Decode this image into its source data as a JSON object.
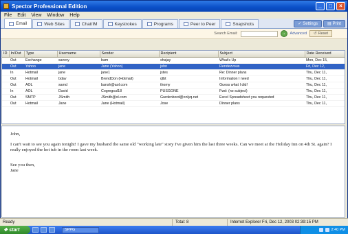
{
  "window": {
    "title": "Spector Professional Edition"
  },
  "menu": [
    "File",
    "Edit",
    "View",
    "Window",
    "Help"
  ],
  "tabs": [
    {
      "label": "Email",
      "icon": "email-icon",
      "active": true
    },
    {
      "label": "Web Sites",
      "icon": "web-icon"
    },
    {
      "label": "Chat/IM",
      "icon": "chat-icon"
    },
    {
      "label": "Keystrokes",
      "icon": "keyboard-icon"
    },
    {
      "label": "Programs",
      "icon": "programs-icon"
    },
    {
      "label": "Peer to Peer",
      "icon": "peer-icon"
    },
    {
      "label": "Snapshots",
      "icon": "camera-icon"
    }
  ],
  "toolbar": {
    "settings": "Settings",
    "print": "Print"
  },
  "search": {
    "label": "Search Email:",
    "advanced": "Advanced",
    "reset": "Reset"
  },
  "columns": [
    "ID",
    "In/Out",
    "Type",
    "Username",
    "Sender",
    "Recipient",
    "Subject",
    "Date Received"
  ],
  "rows": [
    [
      "",
      "Out",
      "Exchange",
      "sanroy",
      "bam",
      "shajay",
      "What's Up",
      "Mon, Dec 15,"
    ],
    [
      "",
      "Out",
      "Yahoo",
      "jane",
      "Jane (Yahoo)",
      "john",
      "Rendezvous",
      "Fri, Dec 12,"
    ],
    [
      "",
      "In",
      "Hotmail",
      "jane",
      "jane1",
      "jstes",
      "Re: Dinner plans",
      "Thu, Dec 11,"
    ],
    [
      "",
      "Out",
      "Hotmail",
      "bdav",
      "BrendDon (Hotmail)",
      "qlbt",
      "Information I need",
      "Thu, Dec 11,"
    ],
    [
      "",
      "Out",
      "AOL",
      "samd",
      "bansh@aol.com",
      "thomy",
      "Guess what I did!",
      "Thu, Dec 11,"
    ],
    [
      "",
      "In",
      "AOL",
      "David",
      "Cogregsul18",
      "PUSGONE",
      "Fwd: (no subject)",
      "Thu, Dec 11,"
    ],
    [
      "",
      "Out",
      "SMTP",
      "JSmith",
      "JSmith@ol.com",
      "Gurdenbord@onlyq.net",
      "Excel Spreadsheet you requested",
      "Thu, Dec 11,"
    ],
    [
      "",
      "Out",
      "Hotmail",
      "Jane",
      "Jane (Hotmail)",
      "Jose",
      "Dinner plans",
      "Thu, Dec 11,"
    ]
  ],
  "selected_row": 1,
  "preview": {
    "greeting": "John,",
    "body": "I can't wait to see you again tonight! I gave my husband the same old \"working late\" story I've given him the last three weeks. Can we meet at the Holiday Inn on 4th St. again? I really enjoyed the hot tub in the room last week.",
    "closing": "See you then,",
    "signature": "Jane"
  },
  "status": {
    "left": "Ready",
    "total": "Total: 8",
    "info": "Internet Explorer  Fri, Dec 12, 2003 02:39:15 PM"
  },
  "taskbar": {
    "start": "start",
    "task": "SPPG",
    "clock": "2:40 PM"
  }
}
